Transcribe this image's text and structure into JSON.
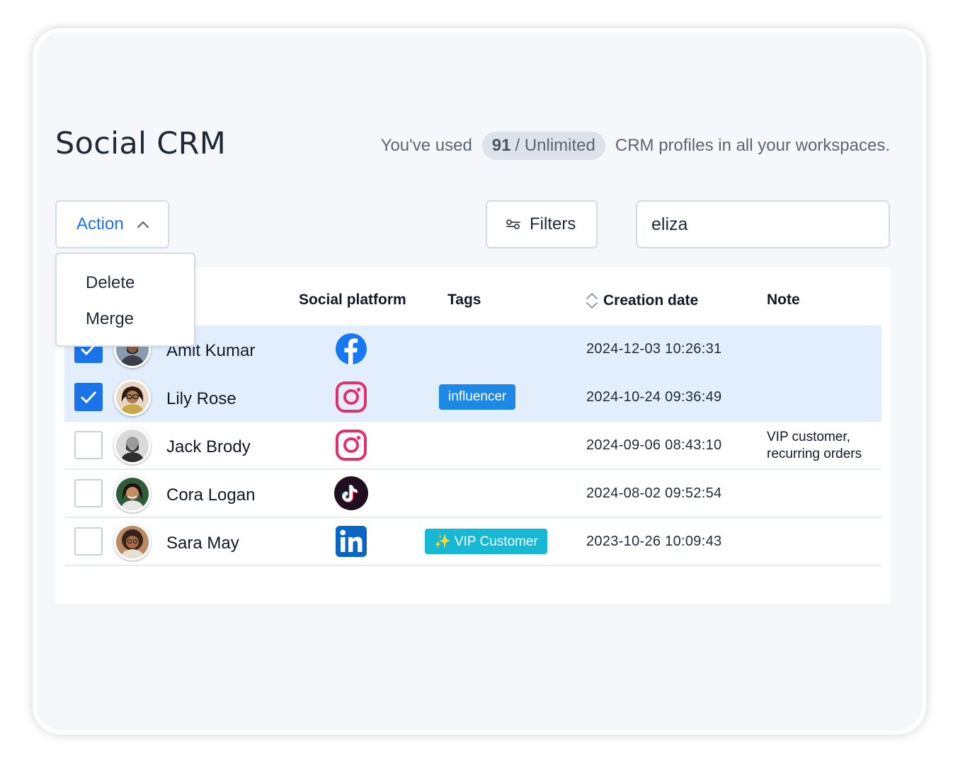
{
  "page": {
    "title": "Social CRM",
    "usage": {
      "prefix": "You've used",
      "count": "91",
      "limit": "/ Unlimited",
      "suffix": "CRM profiles in all your workspaces."
    }
  },
  "toolbar": {
    "action_label": "Action",
    "filters_label": "Filters",
    "search_value": "eliza"
  },
  "action_menu": {
    "items": [
      "Delete",
      "Merge"
    ]
  },
  "table": {
    "columns": {
      "platform": "Social platform",
      "tags": "Tags",
      "date": "Creation date",
      "note": "Note"
    },
    "rows": [
      {
        "name": "Amit Kumar",
        "selected": true,
        "platform": "facebook-icon",
        "tag": "",
        "date": "2024-12-03 10:26:31",
        "note": ""
      },
      {
        "name": "Lily Rose",
        "selected": true,
        "platform": "instagram-icon",
        "tag": "influencer",
        "date": "2024-10-24 09:36:49",
        "note": ""
      },
      {
        "name": "Jack Brody",
        "selected": false,
        "platform": "instagram-icon",
        "tag": "",
        "date": "2024-09-06 08:43:10",
        "note_line1": "VIP customer,",
        "note_line2": "recurring orders"
      },
      {
        "name": "Cora Logan",
        "selected": false,
        "platform": "tiktok-icon",
        "tag": "",
        "date": "2024-08-02 09:52:54",
        "note": ""
      },
      {
        "name": "Sara May",
        "selected": false,
        "platform": "linkedin-icon",
        "tag": "✨ VIP Customer",
        "date": "2023-10-26 10:09:43",
        "note": ""
      }
    ]
  },
  "colors": {
    "accent": "#1a73e8",
    "selected_row": "#e2eefc",
    "tag_influencer": "#1e88e5",
    "tag_vip": "#17b8d4"
  }
}
